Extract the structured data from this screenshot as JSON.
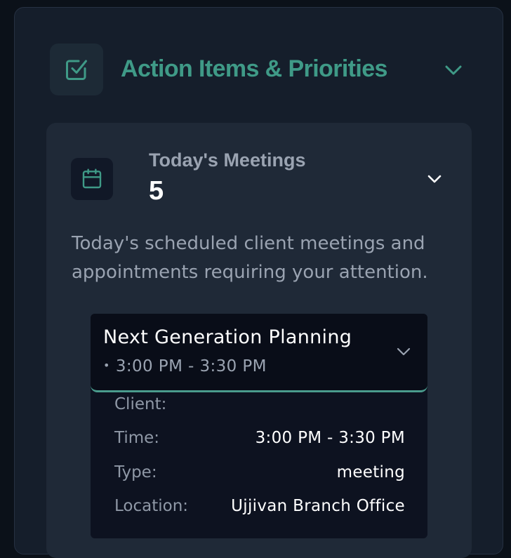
{
  "section": {
    "title": "Action Items & Priorities",
    "icon": "checkbox-icon",
    "accent_color": "#3f9a87"
  },
  "card": {
    "label": "Today's Meetings",
    "value": "5",
    "icon": "calendar-icon",
    "description": "Today's scheduled client meetings and appointments requiring your attention."
  },
  "meeting": {
    "title": "Next Generation Planning",
    "time_range": "3:00 PM - 3:30 PM",
    "details": [
      {
        "key": "Client:",
        "value": ""
      },
      {
        "key": "Time:",
        "value": "3:00 PM - 3:30 PM"
      },
      {
        "key": "Type:",
        "value": "meeting"
      },
      {
        "key": "Location:",
        "value": "Ujjivan Branch Office"
      }
    ]
  }
}
